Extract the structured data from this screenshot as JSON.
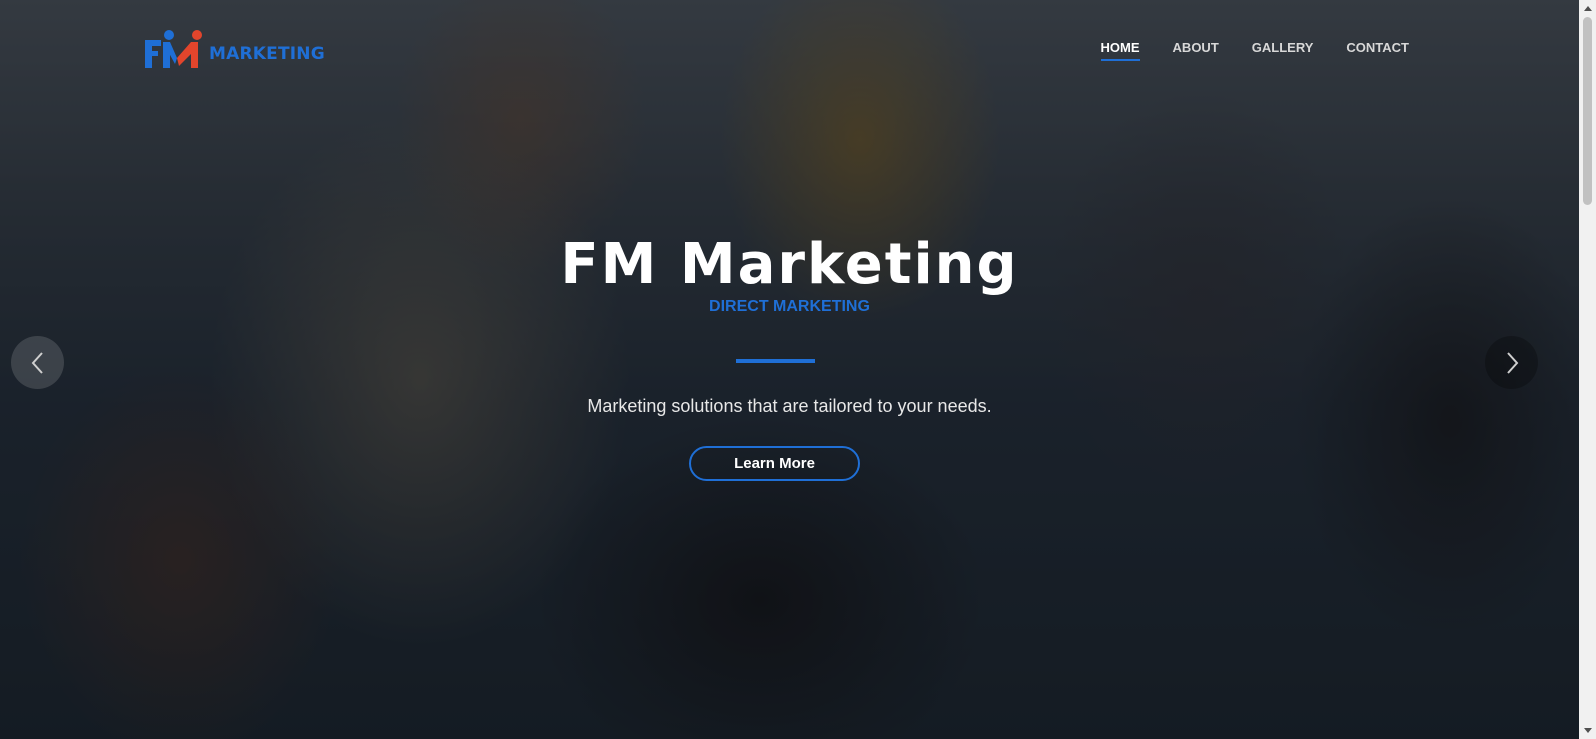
{
  "header": {
    "logo_text": "MARKETING",
    "nav": [
      {
        "label": "HOME",
        "active": true
      },
      {
        "label": "ABOUT",
        "active": false
      },
      {
        "label": "GALLERY",
        "active": false
      },
      {
        "label": "CONTACT",
        "active": false
      }
    ]
  },
  "hero": {
    "title": "FM Marketing",
    "subtitle": "DIRECT MARKETING",
    "tagline": "Marketing solutions that are tailored to your needs.",
    "cta_label": "Learn More",
    "prev_icon": "chevron-left-icon",
    "next_icon": "chevron-right-icon"
  },
  "colors": {
    "accent": "#1f6fd6",
    "logo_red": "#e2452c",
    "nav_active": "#ffffff",
    "nav_inactive": "#d8d8d8"
  }
}
